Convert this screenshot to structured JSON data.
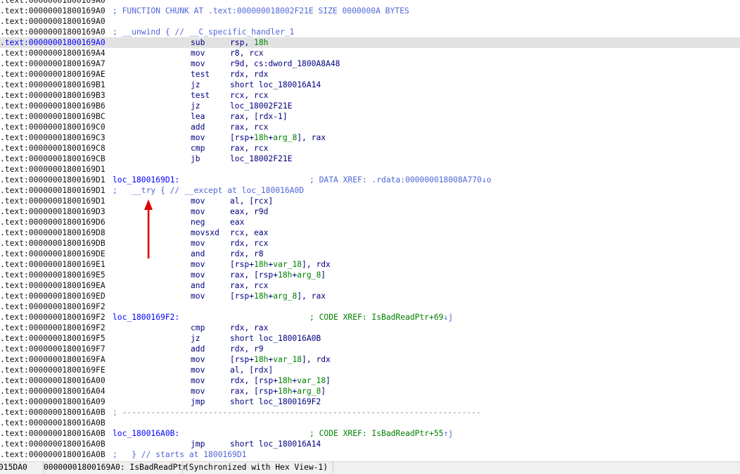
{
  "listing": [
    {
      "addr": ".text:00000001800169A0"
    },
    {
      "addr": ".text:00000001800169A0",
      "comment": "; FUNCTION CHUNK AT .text:000000018002F21E SIZE 0000000A BYTES"
    },
    {
      "addr": ".text:00000001800169A0"
    },
    {
      "addr": ".text:00000001800169A0",
      "comment": "; __unwind { // __C_specific_handler_1"
    },
    {
      "addr": ".text:00000001800169A0",
      "mnemonic": "sub",
      "operands": [
        {
          "t": "rsp, "
        },
        {
          "t": "18h",
          "n": true
        }
      ],
      "highlight": true
    },
    {
      "addr": ".text:00000001800169A4",
      "mnemonic": "mov",
      "operands": [
        {
          "t": "r8, rcx"
        }
      ]
    },
    {
      "addr": ".text:00000001800169A7",
      "mnemonic": "mov",
      "operands": [
        {
          "t": "r9d, cs:dword_1800A8A48"
        }
      ]
    },
    {
      "addr": ".text:00000001800169AE",
      "mnemonic": "test",
      "operands": [
        {
          "t": "rdx, rdx"
        }
      ]
    },
    {
      "addr": ".text:00000001800169B1",
      "mnemonic": "jz",
      "operands": [
        {
          "t": "short loc_180016A14"
        }
      ]
    },
    {
      "addr": ".text:00000001800169B3",
      "mnemonic": "test",
      "operands": [
        {
          "t": "rcx, rcx"
        }
      ]
    },
    {
      "addr": ".text:00000001800169B6",
      "mnemonic": "jz",
      "operands": [
        {
          "t": "loc_18002F21E"
        }
      ]
    },
    {
      "addr": ".text:00000001800169BC",
      "mnemonic": "lea",
      "operands": [
        {
          "t": "rax, [rdx-1]"
        }
      ]
    },
    {
      "addr": ".text:00000001800169C0",
      "mnemonic": "add",
      "operands": [
        {
          "t": "rax, rcx"
        }
      ]
    },
    {
      "addr": ".text:00000001800169C3",
      "mnemonic": "mov",
      "operands": [
        {
          "t": "[rsp+"
        },
        {
          "t": "18h",
          "n": true
        },
        {
          "t": "+"
        },
        {
          "t": "arg_8",
          "n": true
        },
        {
          "t": "], rax"
        }
      ]
    },
    {
      "addr": ".text:00000001800169C8",
      "mnemonic": "cmp",
      "operands": [
        {
          "t": "rax, rcx"
        }
      ]
    },
    {
      "addr": ".text:00000001800169CB",
      "mnemonic": "jb",
      "operands": [
        {
          "t": "loc_18002F21E"
        }
      ]
    },
    {
      "addr": ".text:00000001800169D1"
    },
    {
      "addr": ".text:00000001800169D1",
      "label": "loc_1800169D1:",
      "xref": {
        "text": "; DATA XREF: .rdata:000000018008A770",
        "mark": "↓o",
        "kind": "data"
      }
    },
    {
      "addr": ".text:00000001800169D1",
      "comment": ";   __try { // __except at loc_180016A0D"
    },
    {
      "addr": ".text:00000001800169D1",
      "mnemonic": "mov",
      "operands": [
        {
          "t": "al, [rcx]"
        }
      ]
    },
    {
      "addr": ".text:00000001800169D3",
      "mnemonic": "mov",
      "operands": [
        {
          "t": "eax, r9d"
        }
      ]
    },
    {
      "addr": ".text:00000001800169D6",
      "mnemonic": "neg",
      "operands": [
        {
          "t": "eax"
        }
      ]
    },
    {
      "addr": ".text:00000001800169D8",
      "mnemonic": "movsxd",
      "operands": [
        {
          "t": "rcx, eax"
        }
      ]
    },
    {
      "addr": ".text:00000001800169DB",
      "mnemonic": "mov",
      "operands": [
        {
          "t": "rdx, rcx"
        }
      ]
    },
    {
      "addr": ".text:00000001800169DE",
      "mnemonic": "and",
      "operands": [
        {
          "t": "rdx, r8"
        }
      ]
    },
    {
      "addr": ".text:00000001800169E1",
      "mnemonic": "mov",
      "operands": [
        {
          "t": "[rsp+"
        },
        {
          "t": "18h",
          "n": true
        },
        {
          "t": "+"
        },
        {
          "t": "var_18",
          "n": true
        },
        {
          "t": "], rdx"
        }
      ]
    },
    {
      "addr": ".text:00000001800169E5",
      "mnemonic": "mov",
      "operands": [
        {
          "t": "rax, [rsp+"
        },
        {
          "t": "18h",
          "n": true
        },
        {
          "t": "+"
        },
        {
          "t": "arg_8",
          "n": true
        },
        {
          "t": "]"
        }
      ]
    },
    {
      "addr": ".text:00000001800169EA",
      "mnemonic": "and",
      "operands": [
        {
          "t": "rax, rcx"
        }
      ]
    },
    {
      "addr": ".text:00000001800169ED",
      "mnemonic": "mov",
      "operands": [
        {
          "t": "[rsp+"
        },
        {
          "t": "18h",
          "n": true
        },
        {
          "t": "+"
        },
        {
          "t": "arg_8",
          "n": true
        },
        {
          "t": "], rax"
        }
      ]
    },
    {
      "addr": ".text:00000001800169F2"
    },
    {
      "addr": ".text:00000001800169F2",
      "label": "loc_1800169F2:",
      "xref": {
        "text": "; CODE XREF: IsBadReadPtr+69",
        "mark": "↓j",
        "kind": "code"
      }
    },
    {
      "addr": ".text:00000001800169F2",
      "mnemonic": "cmp",
      "operands": [
        {
          "t": "rdx, rax"
        }
      ]
    },
    {
      "addr": ".text:00000001800169F5",
      "mnemonic": "jz",
      "operands": [
        {
          "t": "short loc_180016A0B"
        }
      ]
    },
    {
      "addr": ".text:00000001800169F7",
      "mnemonic": "add",
      "operands": [
        {
          "t": "rdx, r9"
        }
      ]
    },
    {
      "addr": ".text:00000001800169FA",
      "mnemonic": "mov",
      "operands": [
        {
          "t": "[rsp+"
        },
        {
          "t": "18h",
          "n": true
        },
        {
          "t": "+"
        },
        {
          "t": "var_18",
          "n": true
        },
        {
          "t": "], rdx"
        }
      ]
    },
    {
      "addr": ".text:00000001800169FE",
      "mnemonic": "mov",
      "operands": [
        {
          "t": "al, [rdx]"
        }
      ]
    },
    {
      "addr": ".text:0000000180016A00",
      "mnemonic": "mov",
      "operands": [
        {
          "t": "rdx, [rsp+"
        },
        {
          "t": "18h",
          "n": true
        },
        {
          "t": "+"
        },
        {
          "t": "var_18",
          "n": true
        },
        {
          "t": "]"
        }
      ]
    },
    {
      "addr": ".text:0000000180016A04",
      "mnemonic": "mov",
      "operands": [
        {
          "t": "rax, [rsp+"
        },
        {
          "t": "18h",
          "n": true
        },
        {
          "t": "+"
        },
        {
          "t": "arg_8",
          "n": true
        },
        {
          "t": "]"
        }
      ]
    },
    {
      "addr": ".text:0000000180016A09",
      "mnemonic": "jmp",
      "operands": [
        {
          "t": "short loc_1800169F2"
        }
      ]
    },
    {
      "addr": ".text:0000000180016A0B",
      "separator": "; ---------------------------------------------------------------------------"
    },
    {
      "addr": ".text:0000000180016A0B"
    },
    {
      "addr": ".text:0000000180016A0B",
      "label": "loc_180016A0B:",
      "xref": {
        "text": "; CODE XREF: IsBadReadPtr+55",
        "mark": "↑j",
        "kind": "code"
      }
    },
    {
      "addr": ".text:0000000180016A0B",
      "mnemonic": "jmp",
      "operands": [
        {
          "t": "short loc_180016A14"
        }
      ]
    },
    {
      "addr": ".text:0000000180016A0B",
      "comment": ";   } // starts at 1800169D1"
    }
  ],
  "status": {
    "offset": "015DA0",
    "location": "00000001800169A0: IsBadReadPtr",
    "sync": "(Synchronized with Hex View-1)"
  },
  "colors": {
    "address": "#111111",
    "label": "#0000ff",
    "instruction": "#000080",
    "number": "#008000",
    "comment": "#4f67d8",
    "highlight_row": "#e2e2e2",
    "arrow": "#e00000"
  },
  "annotation": {
    "arrow": "red-up-arrow"
  }
}
